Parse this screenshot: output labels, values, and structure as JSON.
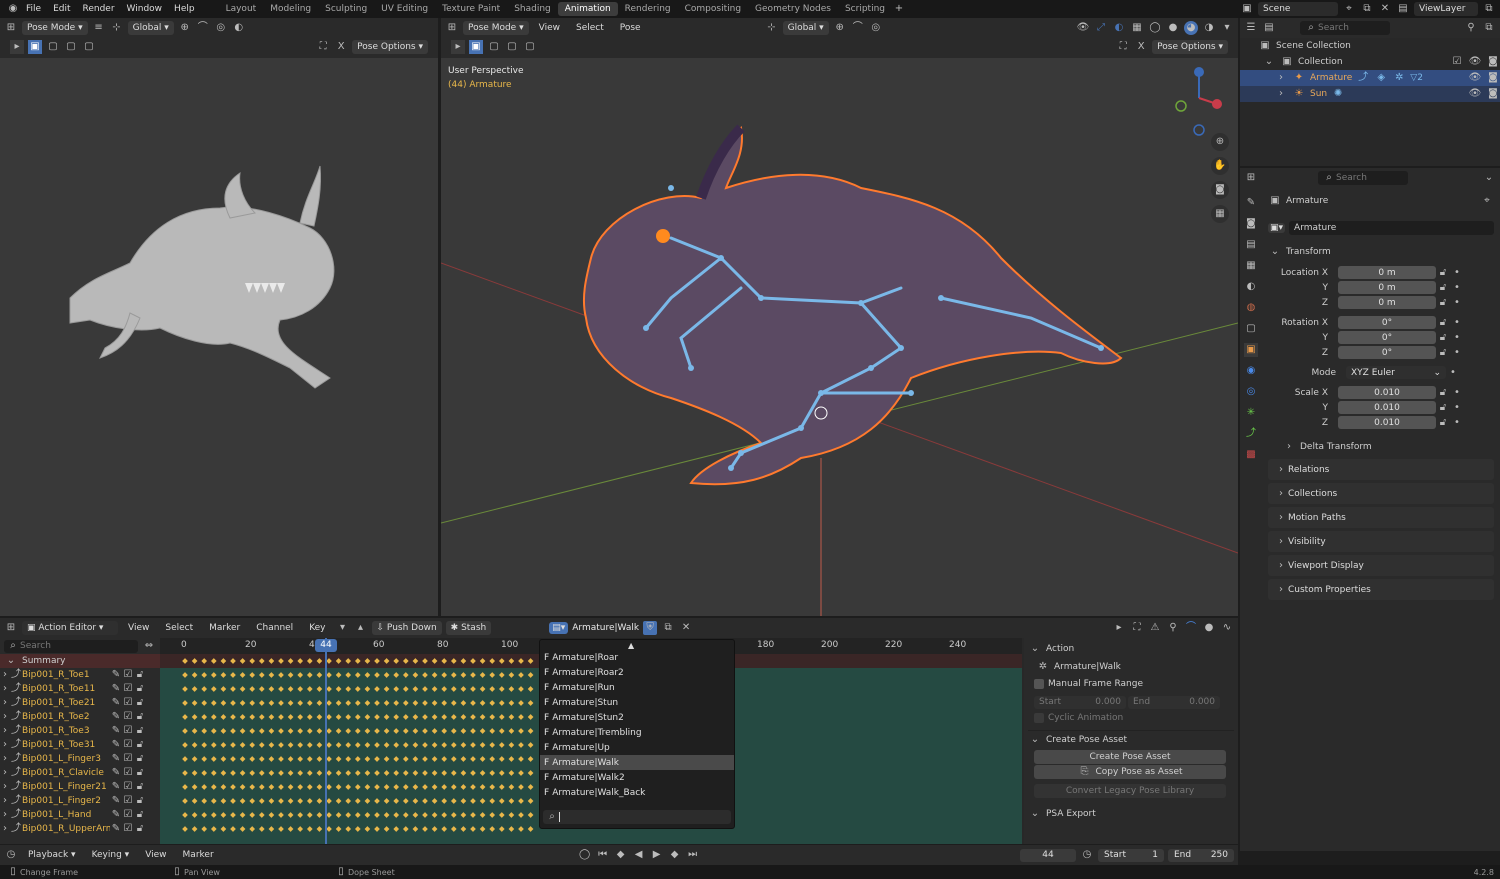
{
  "topbar": {
    "menus": [
      "File",
      "Edit",
      "Render",
      "Window",
      "Help"
    ],
    "workspaces": [
      "Layout",
      "Modeling",
      "Sculpting",
      "UV Editing",
      "Texture Paint",
      "Shading",
      "Animation",
      "Rendering",
      "Compositing",
      "Geometry Nodes",
      "Scripting"
    ],
    "active_workspace": "Animation",
    "scene": "Scene",
    "viewlayer": "ViewLayer"
  },
  "left_view": {
    "mode": "Pose Mode",
    "orientation": "Global",
    "pose_options": "Pose Options"
  },
  "main_view": {
    "mode": "Pose Mode",
    "menus": [
      "View",
      "Select",
      "Pose"
    ],
    "orientation": "Global",
    "pose_options": "Pose Options",
    "perspective": "User Perspective",
    "object_info": "(44) Armature"
  },
  "outliner": {
    "search_placeholder": "Search",
    "scene_collection": "Scene Collection",
    "collection": "Collection",
    "items": [
      {
        "name": "Armature",
        "badge": "2"
      },
      {
        "name": "Sun"
      }
    ]
  },
  "properties": {
    "search_placeholder": "Search",
    "object_name": "Armature",
    "data_name": "Armature",
    "transform_label": "Transform",
    "location_label": "Location X",
    "rotation_label": "Rotation X",
    "scale_label": "Scale X",
    "axis": [
      "Y",
      "Z"
    ],
    "location": [
      "0 m",
      "0 m",
      "0 m"
    ],
    "rotation": [
      "0°",
      "0°",
      "0°"
    ],
    "mode_label": "Mode",
    "mode_value": "XYZ Euler",
    "scale": [
      "0.010",
      "0.010",
      "0.010"
    ],
    "sections": [
      "Delta Transform",
      "Relations",
      "Collections",
      "Motion Paths",
      "Visibility",
      "Viewport Display",
      "Custom Properties"
    ]
  },
  "action_editor": {
    "editor": "Action Editor",
    "menus": [
      "View",
      "Select",
      "Marker",
      "Channel",
      "Key"
    ],
    "push_down": "Push Down",
    "stash": "Stash",
    "action_name": "Armature|Walk",
    "search_placeholder": "Search",
    "frame_ticks_left": [
      "0",
      "20",
      "40",
      "60",
      "80",
      "100"
    ],
    "frame_ticks_right": [
      "180",
      "200",
      "220",
      "240"
    ],
    "current_frame": "44",
    "summary": "Summary",
    "channels": [
      "Bip001_R_Toe1",
      "Bip001_R_Toe11",
      "Bip001_R_Toe21",
      "Bip001_R_Toe2",
      "Bip001_R_Toe3",
      "Bip001_R_Toe31",
      "Bip001_L_Finger3",
      "Bip001_R_Clavicle",
      "Bip001_L_Finger21",
      "Bip001_L_Finger2",
      "Bip001_L_Hand",
      "Bip001_R_UpperArm"
    ]
  },
  "action_dropdown": {
    "items": [
      "Armature|Roar",
      "Armature|Roar2",
      "Armature|Run",
      "Armature|Stun",
      "Armature|Stun2",
      "Armature|Trembling",
      "Armature|Up",
      "Armature|Walk",
      "Armature|Walk2",
      "Armature|Walk_Back"
    ],
    "prefix": "F",
    "selected": "Armature|Walk"
  },
  "side_panel": {
    "action_header": "Action",
    "action_name": "Armature|Walk",
    "manual_frame_range": "Manual Frame Range",
    "start_label": "Start",
    "start_value": "0.000",
    "end_label": "End",
    "end_value": "0.000",
    "cyclic": "Cyclic Animation",
    "create_pose_header": "Create Pose Asset",
    "create_pose_button": "Create Pose Asset",
    "copy_pose_button": "Copy Pose as Asset",
    "convert_button": "Convert Legacy Pose Library",
    "psa_export": "PSA Export"
  },
  "timeline": {
    "menus": [
      "Playback",
      "Keying",
      "View",
      "Marker"
    ],
    "current_frame": "44",
    "start_label": "Start",
    "start": "1",
    "end_label": "End",
    "end": "250"
  },
  "statusbar": {
    "change_frame": "Change Frame",
    "pan_view": "Pan View",
    "dope_sheet": "Dope Sheet",
    "version": "4.2.8"
  },
  "colors": {
    "accent": "#4772b3",
    "keyframe": "#e8b74a",
    "channel_bg": "#2d5a4e",
    "selection_outline": "#ff7a2e",
    "bones": "#7ab8e8"
  }
}
